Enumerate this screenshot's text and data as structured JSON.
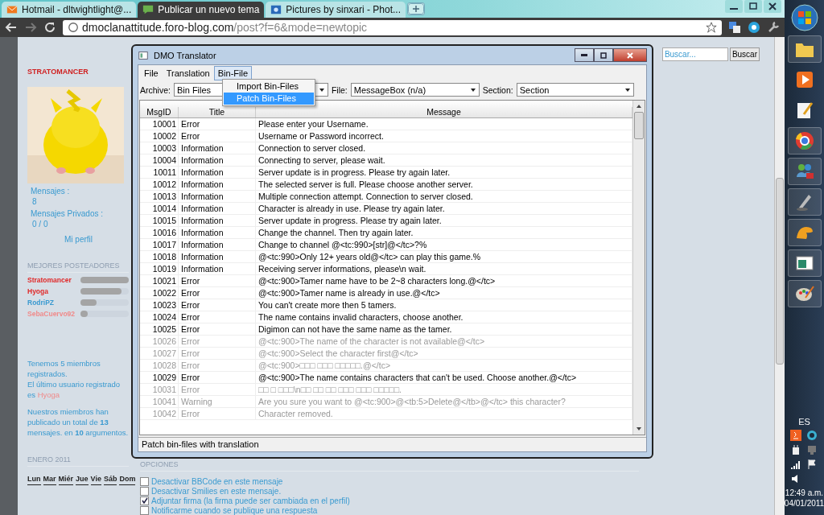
{
  "browser": {
    "tabs": [
      {
        "label": "Hotmail - dltwightlight@...",
        "selected": false
      },
      {
        "label": "Publicar un nuevo tema",
        "selected": true
      },
      {
        "label": "Pictures by sinxari - Phot...",
        "selected": false
      }
    ],
    "address": {
      "host": "dmoclanattitude.foro-blog.com",
      "path": "/post?f=6&mode=newtopic"
    }
  },
  "page": {
    "search": {
      "placeholder": "Buscar...",
      "button": "Buscar"
    },
    "profile": {
      "username": "STRATOMANCER",
      "posts_label": "Mensajes :",
      "posts": "8",
      "pm_label": "Mensajes Privados :",
      "pm": "0 / 0",
      "profile_link": "Mi perfil"
    },
    "top_posters": {
      "title": "MEJORES POSTEADORES",
      "items": [
        {
          "name": "Stratomancer",
          "color": "#e02828",
          "level": 1
        },
        {
          "name": "Hyoga",
          "color": "#e02828",
          "level": 0.85
        },
        {
          "name": "RodriPZ",
          "color": "#3a9ad0",
          "level": 0.33
        },
        {
          "name": "SebaCuervo92",
          "color": "#f08a8a",
          "level": 0.15
        }
      ]
    },
    "stats": {
      "members": "Tenemos 5 miembros registrados.",
      "last_user_text": "El último usuario registrado es",
      "last_user": "Hyoga",
      "totals": "Nuestros miembros han publicado un total de **13** mensajes. en **10** argumentos."
    },
    "calendar": {
      "title": "ENERO 2011",
      "days": [
        "Lun",
        "Mar",
        "Miér",
        "Jue",
        "Vie",
        "Sáb",
        "Dom"
      ]
    },
    "options": {
      "title": "OPCIONES",
      "items": [
        {
          "label": "Desactivar BBCode en este mensaje",
          "checked": false
        },
        {
          "label": "Desactivar Smilies en este mensaje.",
          "checked": false
        },
        {
          "label": "Adjuntar firma (la firma puede ser cambiada en el perfil)",
          "checked": true
        },
        {
          "label": "Notificarme cuando se publique una respuesta",
          "checked": false
        }
      ]
    }
  },
  "dialog": {
    "title": "DMO Translator",
    "menu": [
      {
        "label": "File",
        "selected": false
      },
      {
        "label": "Translation",
        "selected": false
      },
      {
        "label": "Bin-File",
        "selected": true
      }
    ],
    "dropdown": [
      {
        "label": "Import Bin-Files",
        "selected": false
      },
      {
        "label": "Patch Bin-Files",
        "selected": true
      }
    ],
    "filters": [
      {
        "label": "Archive:",
        "value": "Bin Files"
      },
      {
        "label": "File:",
        "value": "MessageBox (n/a)"
      },
      {
        "label": "Section:",
        "value": "Section"
      }
    ],
    "columns": [
      "MsgID",
      "Title",
      "Message"
    ],
    "rows": [
      {
        "id": "10001",
        "title": "Error",
        "message": "Please enter your Username.",
        "dimmed": false
      },
      {
        "id": "10002",
        "title": "Error",
        "message": "Username or Password incorrect.",
        "dimmed": false
      },
      {
        "id": "10003",
        "title": "Information",
        "message": "Connection to server closed.",
        "dimmed": false
      },
      {
        "id": "10004",
        "title": "Information",
        "message": "Connecting to server, please wait.",
        "dimmed": false
      },
      {
        "id": "10011",
        "title": "Information",
        "message": "Server update is in progress. Please try again later.",
        "dimmed": false
      },
      {
        "id": "10012",
        "title": "Information",
        "message": "The selected server is full. Please choose another server.",
        "dimmed": false
      },
      {
        "id": "10013",
        "title": "Information",
        "message": "Multiple connection attempt. Connection to server closed.",
        "dimmed": false
      },
      {
        "id": "10014",
        "title": "Information",
        "message": "Character is already in use. Please try again later.",
        "dimmed": false
      },
      {
        "id": "10015",
        "title": "Information",
        "message": "Server update in progress. Please try again later.",
        "dimmed": false
      },
      {
        "id": "10016",
        "title": "Information",
        "message": "Change the channel. Then try again later.",
        "dimmed": false
      },
      {
        "id": "10017",
        "title": "Information",
        "message": "Change to channel @<tc:990>[str]@</tc>?%",
        "dimmed": false
      },
      {
        "id": "10018",
        "title": "Information",
        "message": "@<tc:990>Only 12+ years old@</tc> can play this game.%",
        "dimmed": false
      },
      {
        "id": "10019",
        "title": "Information",
        "message": "Receiving server informations, please\\n wait.",
        "dimmed": false
      },
      {
        "id": "10021",
        "title": "Error",
        "message": "@<tc:900>Tamer name have to be 2~8 characters long.@</tc>",
        "dimmed": false
      },
      {
        "id": "10022",
        "title": "Error",
        "message": "@<tc:900>Tamer name is already in use.@</tc>",
        "dimmed": false
      },
      {
        "id": "10023",
        "title": "Error",
        "message": "You can't create more then 5 tamers.",
        "dimmed": false
      },
      {
        "id": "10024",
        "title": "Error",
        "message": "The name contains invalid characters, choose another.",
        "dimmed": false
      },
      {
        "id": "10025",
        "title": "Error",
        "message": "Digimon can not have the same name as the tamer.",
        "dimmed": false
      },
      {
        "id": "10026",
        "title": "Error",
        "message": "@<tc:900>The name of the character is not available@</tc>",
        "dimmed": true
      },
      {
        "id": "10027",
        "title": "Error",
        "message": "@<tc:900>Select the character first@</tc>",
        "dimmed": true
      },
      {
        "id": "10028",
        "title": "Error",
        "message": "@<tc:900>□□□ □□□ □□□□□.@</tc>",
        "dimmed": true
      },
      {
        "id": "10029",
        "title": "Error",
        "message": "@<tc:900>The name contains characters that can't be used. Choose another.@</tc>",
        "dimmed": false
      },
      {
        "id": "10031",
        "title": "Error",
        "message": "□□ □ □□□\\n□□ □□ □□ □□□ □□□ □□□□□.",
        "dimmed": true
      },
      {
        "id": "10041",
        "title": "Warning",
        "message": "Are you sure you want to @<tc:900>@<tb:5>Delete@</tb>@</tc> this character?",
        "dimmed": true
      },
      {
        "id": "10042",
        "title": "Error",
        "message": "Character removed.",
        "dimmed": true
      }
    ],
    "status": "Patch bin-files with translation"
  },
  "taskbar": {
    "language": "ES",
    "time": "12:49 a.m.",
    "date": "04/01/2011"
  }
}
